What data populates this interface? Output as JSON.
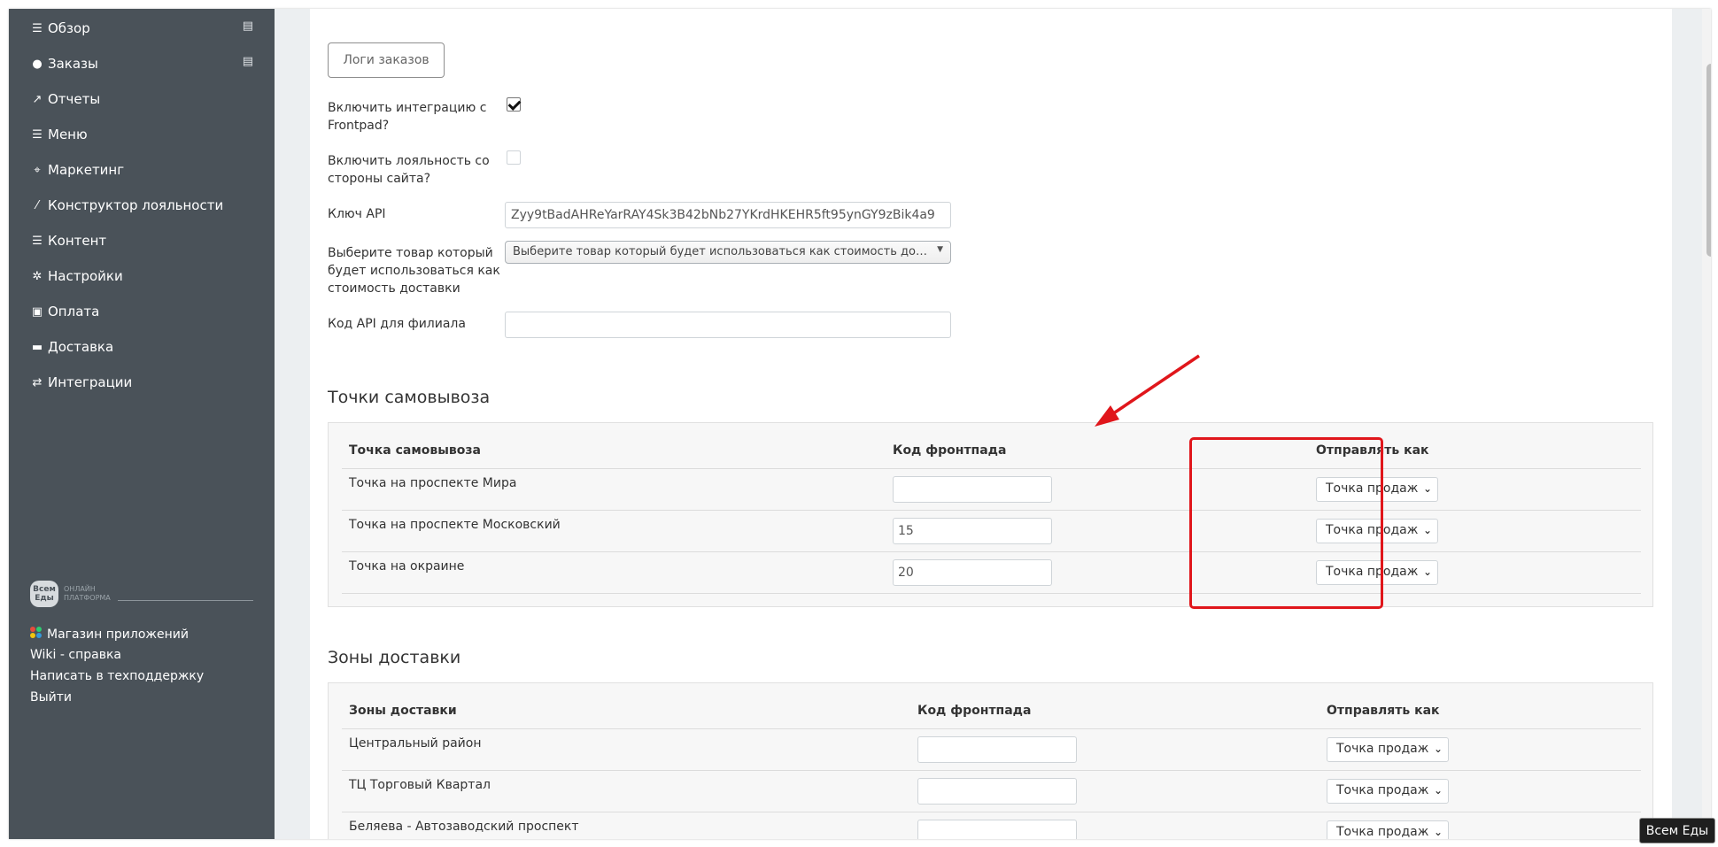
{
  "sidebar": {
    "items": [
      {
        "label": "Обзор",
        "icon": "list-icon",
        "badge": true
      },
      {
        "label": "Заказы",
        "icon": "circle-icon",
        "badge": true
      },
      {
        "label": "Отчеты",
        "icon": "chart-line-icon"
      },
      {
        "label": "Меню",
        "icon": "list-icon"
      },
      {
        "label": "Маркетинг",
        "icon": "crosshair-icon"
      },
      {
        "label": "Конструктор лояльности",
        "icon": "magic-wand-icon"
      },
      {
        "label": "Контент",
        "icon": "list-icon"
      },
      {
        "label": "Настройки",
        "icon": "gear-icon"
      },
      {
        "label": "Оплата",
        "icon": "money-icon"
      },
      {
        "label": "Доставка",
        "icon": "truck-icon"
      },
      {
        "label": "Интеграции",
        "icon": "exchange-icon"
      }
    ],
    "logo": {
      "mark": "Всем Еды",
      "line1": "ОНЛАЙН",
      "line2": "ПЛАТФОРМА"
    },
    "footer": {
      "app_store": "Магазин приложений",
      "wiki": "Wiki - справка",
      "support": "Написать в техподдержку",
      "logout": "Выйти"
    }
  },
  "form": {
    "logs_button": "Логи заказов",
    "frontpad_label": "Включить интеграцию с Frontpad?",
    "frontpad_checked": true,
    "loyalty_label": "Включить лояльность со стороны сайта?",
    "loyalty_checked": false,
    "api_key_label": "Ключ API",
    "api_key_value": "Zyy9tBadAHReYarRAY4Sk3B42bNb27YKrdHKEHR5ft95ynGY9zBik4a9",
    "delivery_product_label": "Выберите товар который будет использоваться как стоимость доставки",
    "delivery_product_placeholder": "Выберите товар который будет использоваться как стоимость доставки",
    "branch_code_label": "Код API для филиала",
    "branch_code_value": ""
  },
  "pickup": {
    "title": "Точки самовывоза",
    "headers": [
      "Точка самовывоза",
      "Код фронтпада",
      "Отправлять как"
    ],
    "rows": [
      {
        "name": "Точка на проспекте Мира",
        "code": "",
        "send_as": "Точка продаж"
      },
      {
        "name": "Точка на проспекте Московский",
        "code": "15",
        "send_as": "Точка продаж"
      },
      {
        "name": "Точка на окраине",
        "code": "20",
        "send_as": "Точка продаж"
      }
    ]
  },
  "zones": {
    "title": "Зоны доставки",
    "headers": [
      "Зоны доставки",
      "Код фронтпада",
      "Отправлять как"
    ],
    "rows": [
      {
        "name": "Центральный район",
        "code": "",
        "send_as": "Точка продаж"
      },
      {
        "name": "ТЦ Торговый Квартал",
        "code": "",
        "send_as": "Точка продаж"
      },
      {
        "name": "Беляева - Автозаводский проспект",
        "code": "",
        "send_as": "Точка продаж"
      }
    ]
  },
  "badge": "Всем Еды",
  "colors": {
    "sidebar": "#4a5259",
    "highlight": "#e0161b",
    "page_bg": "#eceff1"
  }
}
